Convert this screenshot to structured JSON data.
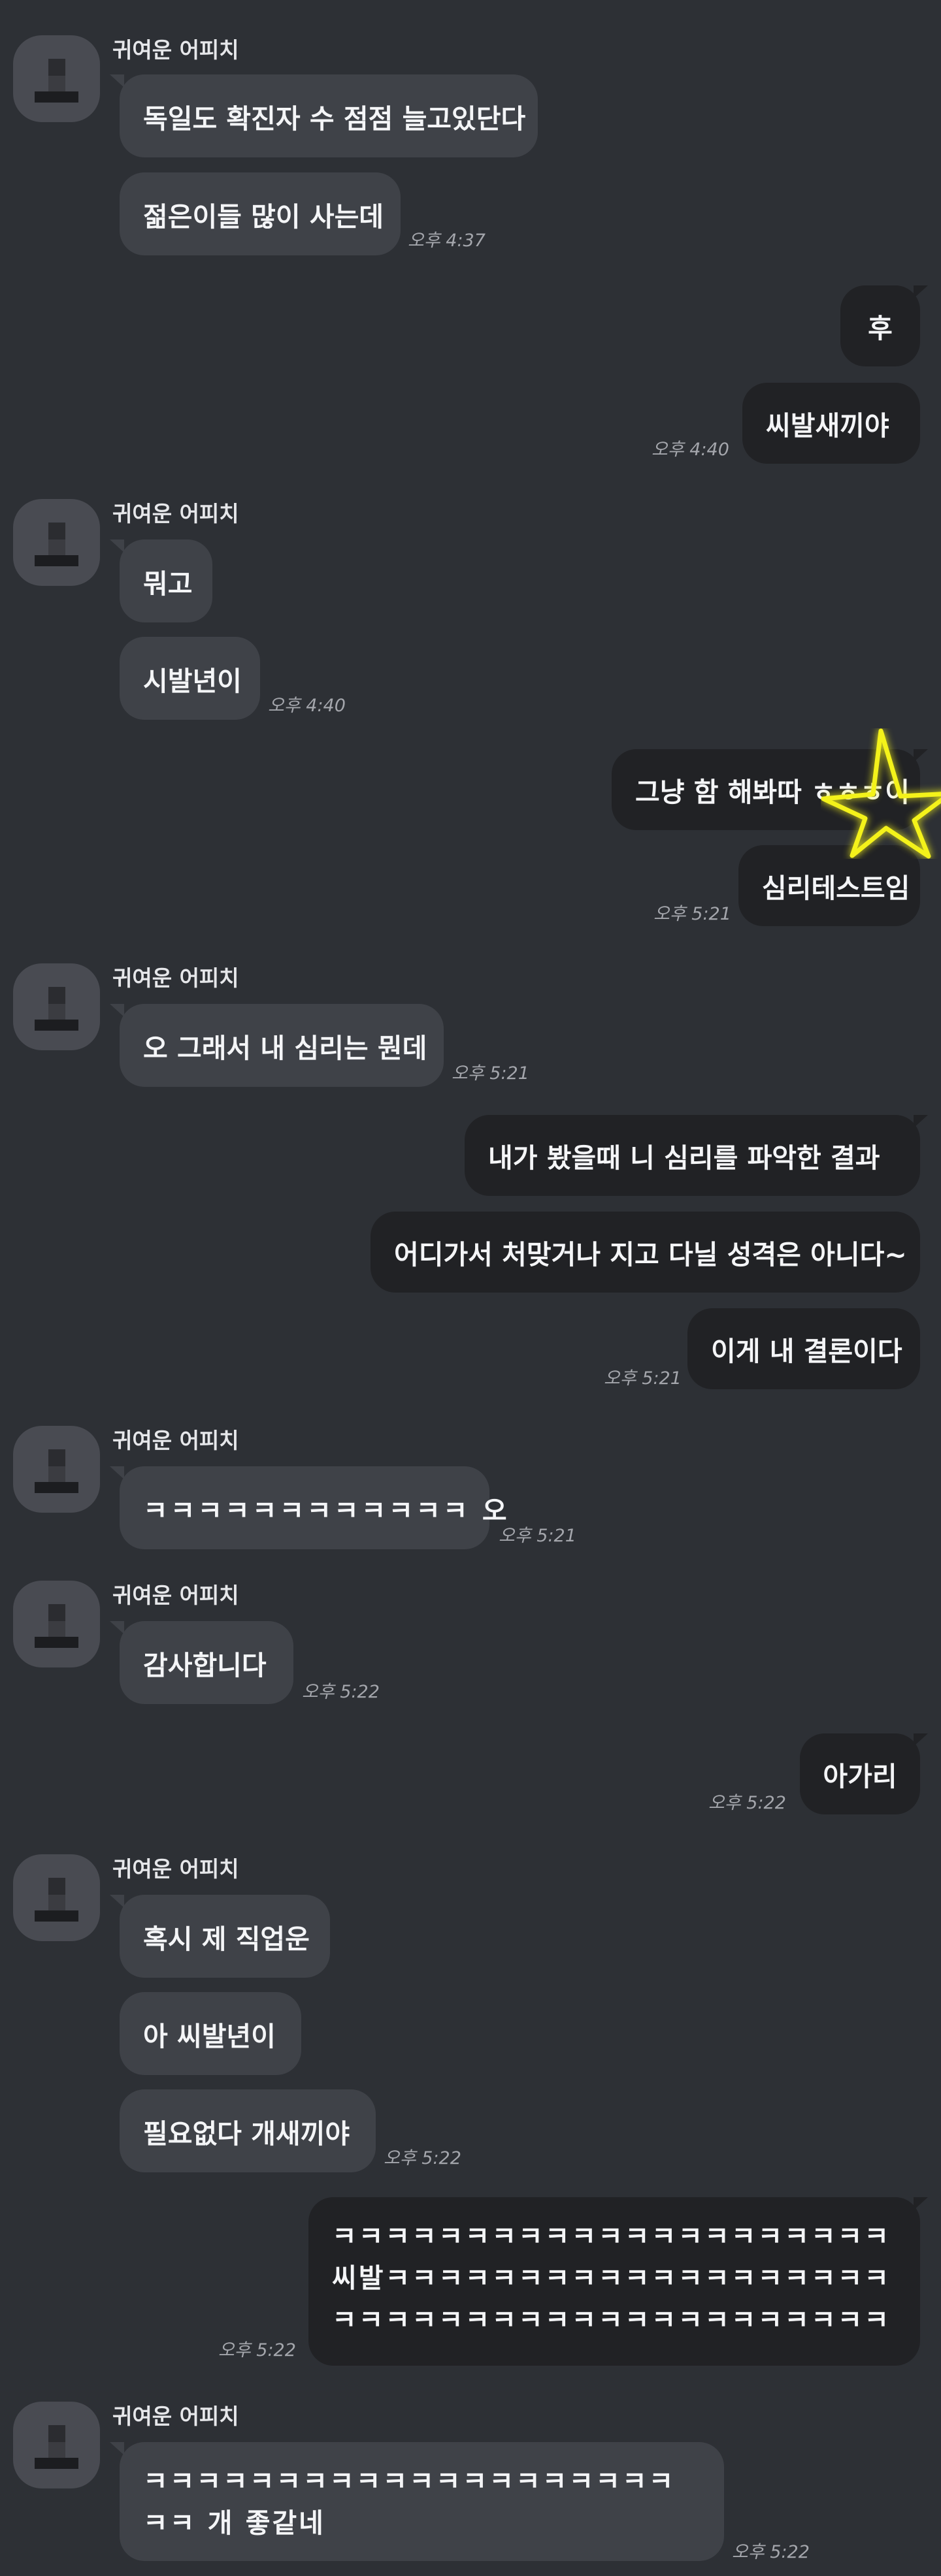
{
  "contact_name": "귀여운 어피치",
  "messages": {
    "m1": "독일도 확진자 수 점점 늘고있단다",
    "m2": "젊은이들 많이 사는데",
    "t1": "오후 4:37",
    "m3": "후",
    "m4": "씨발새끼야",
    "t2": "오후 4:40",
    "m5": "뭐고",
    "m6": "시발년이",
    "t3": "오후 4:40",
    "m7": "그냥 함 해봐따 ㅎㅎㅎ이",
    "m8": "심리테스트임",
    "t4": "오후 5:21",
    "m9": "오 그래서 내 심리는 뭔데",
    "t5": "오후 5:21",
    "m10": "내가 봤을때 니 심리를 파악한 결과",
    "m11": "어디가서 처맞거나 지고 다닐 성격은 아니다~",
    "m12": "이게 내 결론이다",
    "t6": "오후 5:21",
    "m13": "ㅋㅋㅋㅋㅋㅋㅋㅋㅋㅋㅋㅋ 오",
    "t7": "오후 5:21",
    "m14": "감사합니다",
    "t8": "오후 5:22",
    "m15": "아가리",
    "t9": "오후 5:22",
    "m16": "혹시 제 직업운",
    "m17": "아 씨발년이",
    "m18": "필요없다 개새끼야",
    "t10": "오후 5:22",
    "m19": "ㅋㅋㅋㅋㅋㅋㅋㅋㅋㅋㅋㅋㅋㅋㅋㅋㅋㅋㅋㅋㅋ씨발ㅋㅋㅋㅋㅋㅋㅋㅋㅋㅋㅋㅋㅋㅋㅋㅋㅋㅋㅋㅋㅋㅋㅋㅋㅋㅋㅋㅋㅋㅋㅋㅋㅋㅋㅋㅋㅋㅋㅋㅋ",
    "t11": "오후 5:22",
    "m20": "ㅋㅋㅋㅋㅋㅋㅋㅋㅋㅋㅋㅋㅋㅋㅋㅋㅋㅋㅋㅋㅋㅋ 개 좋같네",
    "t12": "오후 5:22"
  },
  "colors": {
    "background": "#2d3035",
    "incoming_bubble": "#3f4248",
    "outgoing_bubble": "#212225",
    "star": "#f4f21a"
  },
  "icons": {
    "star_sticker": "yellow-star-outline-icon",
    "avatar": "blurred-avatar-icon"
  }
}
